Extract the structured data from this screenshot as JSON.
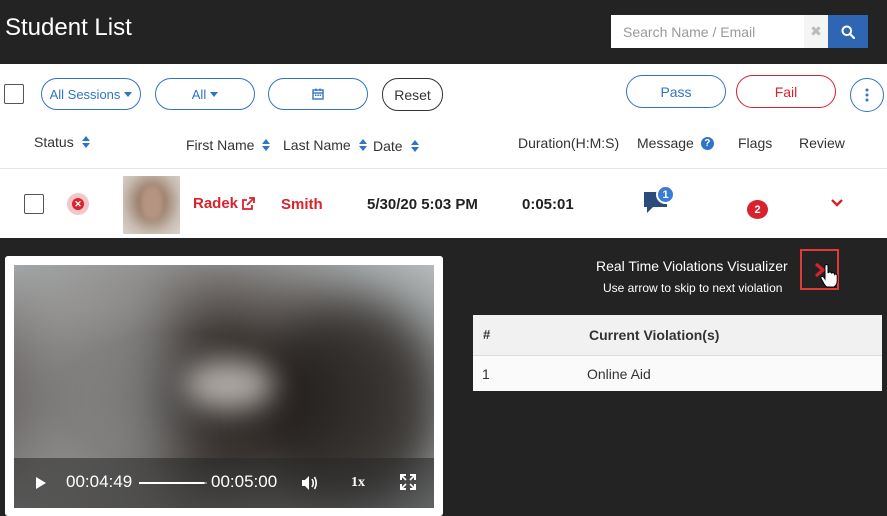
{
  "header": {
    "title": "Student List",
    "search_placeholder": "Search Name / Email",
    "clear_glyph": "✖"
  },
  "filters": {
    "sessions_label": "All Sessions",
    "all_label": "All",
    "reset_label": "Reset",
    "pass_label": "Pass",
    "fail_label": "Fail"
  },
  "columns": {
    "status": "Status",
    "first_name": "First Name",
    "last_name": "Last Name",
    "date": "Date",
    "duration": "Duration(H:M:S)",
    "message": "Message",
    "flags": "Flags",
    "review": "Review"
  },
  "row": {
    "first_name": "Radek",
    "last_name": "Smith",
    "date": "5/30/20 5:03 PM",
    "duration": "0:05:01",
    "message_count": "1",
    "flags_count": "2",
    "status_glyph": "✕"
  },
  "video": {
    "current_time": "00:04:49",
    "total_time": "00:05:00",
    "speed": "1x",
    "progress": 0.963
  },
  "violations": {
    "title": "Real Time Violations Visualizer",
    "subtitle": "Use arrow to skip to next violation",
    "col_index": "#",
    "col_name": "Current Violation(s)",
    "rows": [
      {
        "index": "1",
        "name": "Online Aid"
      }
    ]
  },
  "colors": {
    "accent_blue": "#2f74c5",
    "danger_red": "#d8222d",
    "dark_bg": "#232323"
  },
  "icons": {
    "search": "search-icon",
    "calendar": "calendar-icon",
    "more": "more-vertical-icon",
    "external": "external-link-icon",
    "message": "chat-icon",
    "next": "chevron-right-icon",
    "review": "chevron-down-icon"
  }
}
